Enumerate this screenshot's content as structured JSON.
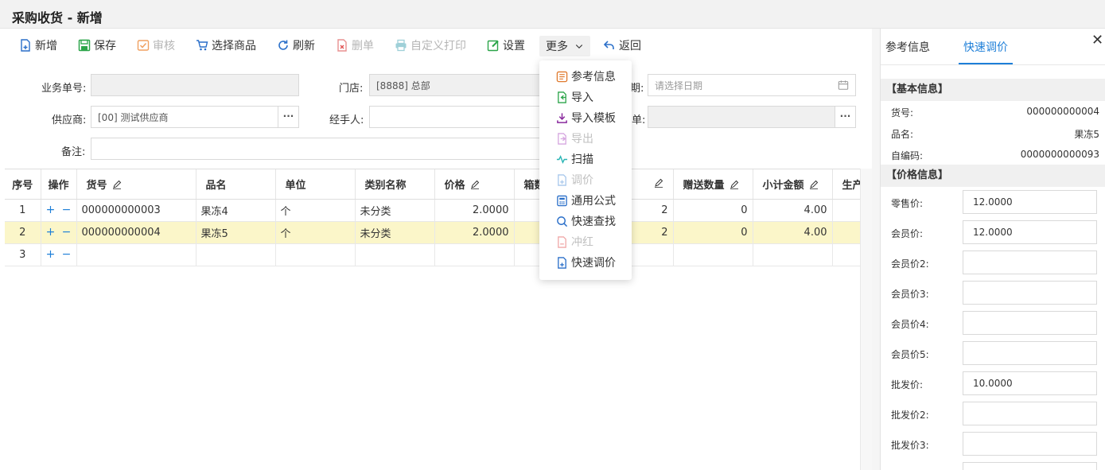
{
  "page": {
    "title": "采购收货 - 新增"
  },
  "toolbar": {
    "new": "新增",
    "save": "保存",
    "audit": "审核",
    "select_goods": "选择商品",
    "refresh": "刷新",
    "delete": "删单",
    "custom_print": "自定义打印",
    "settings": "设置",
    "more": "更多",
    "back": "返回"
  },
  "form": {
    "order_no_label": "业务单号:",
    "store_label": "门店:",
    "store_value": "[8888] 总部",
    "date_label_partial": "期:",
    "date_placeholder": "请选择日期",
    "supplier_label": "供应商:",
    "supplier_value": "[00] 测试供应商",
    "handler_label": "经手人:",
    "doc_label_partial": "单:",
    "remark_label": "备注:",
    "dots": "···"
  },
  "more_menu": [
    {
      "label": "参考信息",
      "icon": "reference-info-icon",
      "enabled": true
    },
    {
      "label": "导入",
      "icon": "import-icon",
      "enabled": true
    },
    {
      "label": "导入模板",
      "icon": "download-icon",
      "enabled": true
    },
    {
      "label": "导出",
      "icon": "export-icon",
      "enabled": false
    },
    {
      "label": "扫描",
      "icon": "scan-icon",
      "enabled": true
    },
    {
      "label": "调价",
      "icon": "adjust-price-icon",
      "enabled": false
    },
    {
      "label": "通用公式",
      "icon": "calculator-icon",
      "enabled": true
    },
    {
      "label": "快速查找",
      "icon": "search-icon",
      "enabled": true
    },
    {
      "label": "冲红",
      "icon": "reverse-icon",
      "enabled": false
    },
    {
      "label": "快速调价",
      "icon": "quick-adjust-icon",
      "enabled": true
    }
  ],
  "grid": {
    "headers": {
      "seq": "序号",
      "op": "操作",
      "code": "货号",
      "name": "品名",
      "unit": "单位",
      "category": "类别名称",
      "price": "价格",
      "box_partial": "箱数",
      "hidden_col_partial": "",
      "gift_qty": "赠送数量",
      "subtotal": "小计金额",
      "prod_date_partial": "生产日"
    },
    "plus": "+",
    "minus": "−",
    "rows": [
      {
        "seq": "1",
        "code": "000000000003",
        "name": "果冻4",
        "unit": "个",
        "category": "未分类",
        "price": "2.0000",
        "qty": "2",
        "gift": "0",
        "subtotal": "4.00"
      },
      {
        "seq": "2",
        "code": "000000000004",
        "name": "果冻5",
        "unit": "个",
        "category": "未分类",
        "price": "2.0000",
        "qty": "2",
        "gift": "0",
        "subtotal": "4.00"
      },
      {
        "seq": "3",
        "code": "",
        "name": "",
        "unit": "",
        "category": "",
        "price": "",
        "qty": "",
        "gift": "",
        "subtotal": ""
      }
    ]
  },
  "panel": {
    "tab_reference": "参考信息",
    "tab_quick_price": "快速调价",
    "close": "✕",
    "basic_section": "【基本信息】",
    "code_label": "货号:",
    "code_value": "000000000004",
    "name_label": "品名:",
    "name_value": "果冻5",
    "selfcode_label": "自编码:",
    "selfcode_value": "0000000000093",
    "price_section": "【价格信息】",
    "prices": [
      {
        "label": "零售价:",
        "value": "12.0000"
      },
      {
        "label": "会员价:",
        "value": "12.0000"
      },
      {
        "label": "会员价2:",
        "value": ""
      },
      {
        "label": "会员价3:",
        "value": ""
      },
      {
        "label": "会员价4:",
        "value": ""
      },
      {
        "label": "会员价5:",
        "value": ""
      },
      {
        "label": "批发价:",
        "value": "10.0000"
      },
      {
        "label": "批发价2:",
        "value": ""
      },
      {
        "label": "批发价3:",
        "value": ""
      }
    ]
  },
  "colors": {
    "accent": "#1e7fd8",
    "selected_row": "#fbf6c9",
    "disabled_text": "#b5b5b5"
  }
}
